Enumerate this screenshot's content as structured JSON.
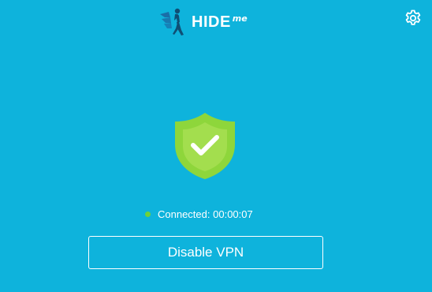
{
  "header": {
    "logo_text": "HIDE",
    "logo_suffix": "me",
    "logo_icon": "walking-person-wings-icon",
    "settings_icon": "gear-icon"
  },
  "status": {
    "shield_icon": "shield-check-icon",
    "indicator_color": "#6fd13a",
    "label": "Connected:",
    "duration": "00:00:07"
  },
  "actions": {
    "disable_label": "Disable VPN"
  },
  "colors": {
    "background": "#0eb3dc",
    "shield": "#8ed63b",
    "shield_inner": "#a8e050",
    "logo_mark": "#0f5e8a"
  }
}
